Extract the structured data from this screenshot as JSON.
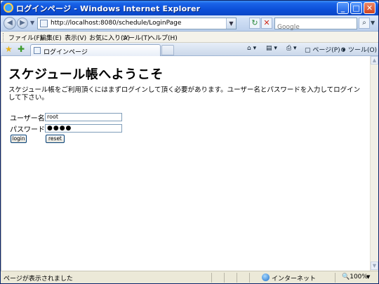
{
  "window": {
    "title": "ログインページ - Windows Internet Explorer"
  },
  "address_bar": {
    "url": "http://localhost:8080/schedule/LoginPage",
    "search_placeholder": "Google"
  },
  "menu": {
    "items": [
      "ファイル(F)",
      "編集(E)",
      "表示(V)",
      "お気に入り(A)",
      "ツール(T)",
      "ヘルプ(H)"
    ]
  },
  "tabs": [
    {
      "label": "ログインページ"
    }
  ],
  "command_bar": {
    "page_label": "ページ(P)",
    "tools_label": "ツール(O)"
  },
  "page": {
    "heading": "スケジュール帳へようこそ",
    "intro": "スケジュール帳をご利用頂くにはまずログインして頂く必要があります。ユーザー名とパスワードを入力してログインして下さい。",
    "username_label": "ユーザー名",
    "username_value": "root",
    "password_label": "パスワード",
    "password_dots": "●●●●",
    "login_button": "login",
    "reset_button": "reset"
  },
  "status_bar": {
    "text": "ページが表示されました",
    "zone": "インターネット",
    "zoom": "100%"
  },
  "icons": {
    "back": "back-arrow-icon",
    "forward": "forward-arrow-icon",
    "refresh": "refresh-icon",
    "stop": "stop-icon",
    "search": "search-icon",
    "favorites": "favorites-star-icon",
    "add_favorites": "add-favorites-icon",
    "home": "home-icon",
    "feeds": "feeds-icon",
    "print": "print-icon",
    "internet_zone": "globe-icon"
  }
}
